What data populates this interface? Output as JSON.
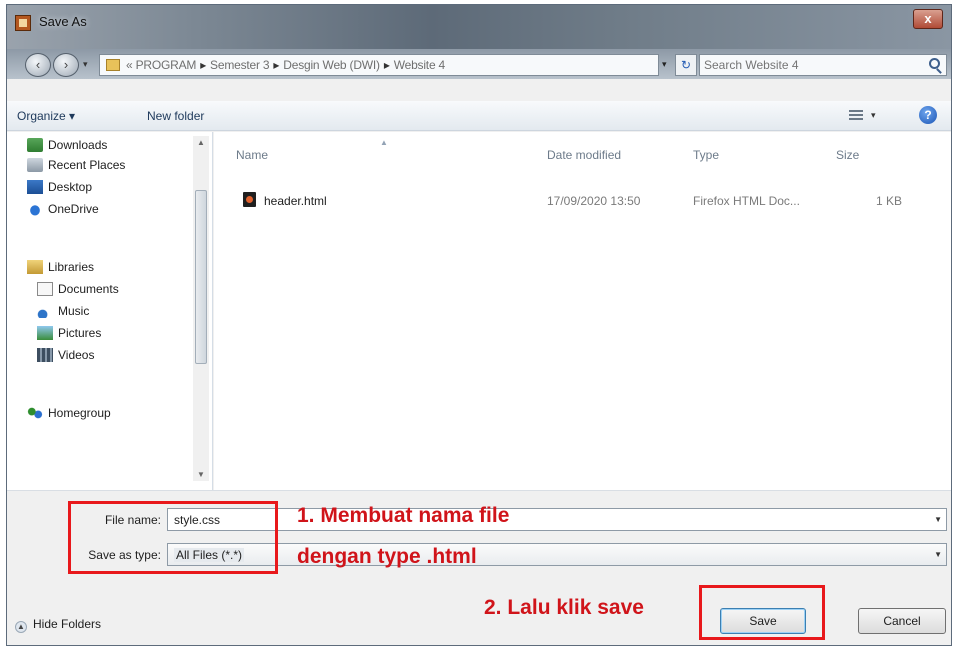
{
  "window": {
    "title": "Save As",
    "close_glyph": "x"
  },
  "address": {
    "breadcrumbs": [
      "« PROGRAM",
      "Semester 3",
      "Desgin Web (DWI)",
      "Website 4"
    ],
    "search_placeholder": "Search Website 4"
  },
  "toolbar": {
    "organize_label": "Organize ▾",
    "new_folder_label": "New folder"
  },
  "nav_pane": {
    "items": [
      {
        "label": "Downloads",
        "icon": "downloads-icon"
      },
      {
        "label": "Recent Places",
        "icon": "recent-places-icon"
      },
      {
        "label": "Desktop",
        "icon": "desktop-icon"
      },
      {
        "label": "OneDrive",
        "icon": "onedrive-icon"
      },
      {
        "label": "Libraries",
        "icon": "libraries-icon"
      },
      {
        "label": "Documents",
        "icon": "documents-icon"
      },
      {
        "label": "Music",
        "icon": "music-icon"
      },
      {
        "label": "Pictures",
        "icon": "pictures-icon"
      },
      {
        "label": "Videos",
        "icon": "videos-icon"
      },
      {
        "label": "Homegroup",
        "icon": "homegroup-icon"
      }
    ]
  },
  "file_list": {
    "columns": {
      "name": "Name",
      "date": "Date modified",
      "type": "Type",
      "size": "Size"
    },
    "rows": [
      {
        "name": "header.html",
        "date": "17/09/2020 13:50",
        "type": "Firefox HTML Doc...",
        "size": "1 KB"
      }
    ]
  },
  "form": {
    "file_name_label": "File name:",
    "file_name_value": "style.css",
    "save_type_label": "Save as type:",
    "save_type_value": "All Files (*.*)"
  },
  "footer": {
    "hide_folders_label": "Hide Folders",
    "save_label": "Save",
    "cancel_label": "Cancel"
  },
  "annotations": {
    "step1_line1": "1. Membuat nama file",
    "step1_line2": "dengan type .html",
    "step2": "2. Lalu klik save",
    "color": "#e8181b"
  }
}
